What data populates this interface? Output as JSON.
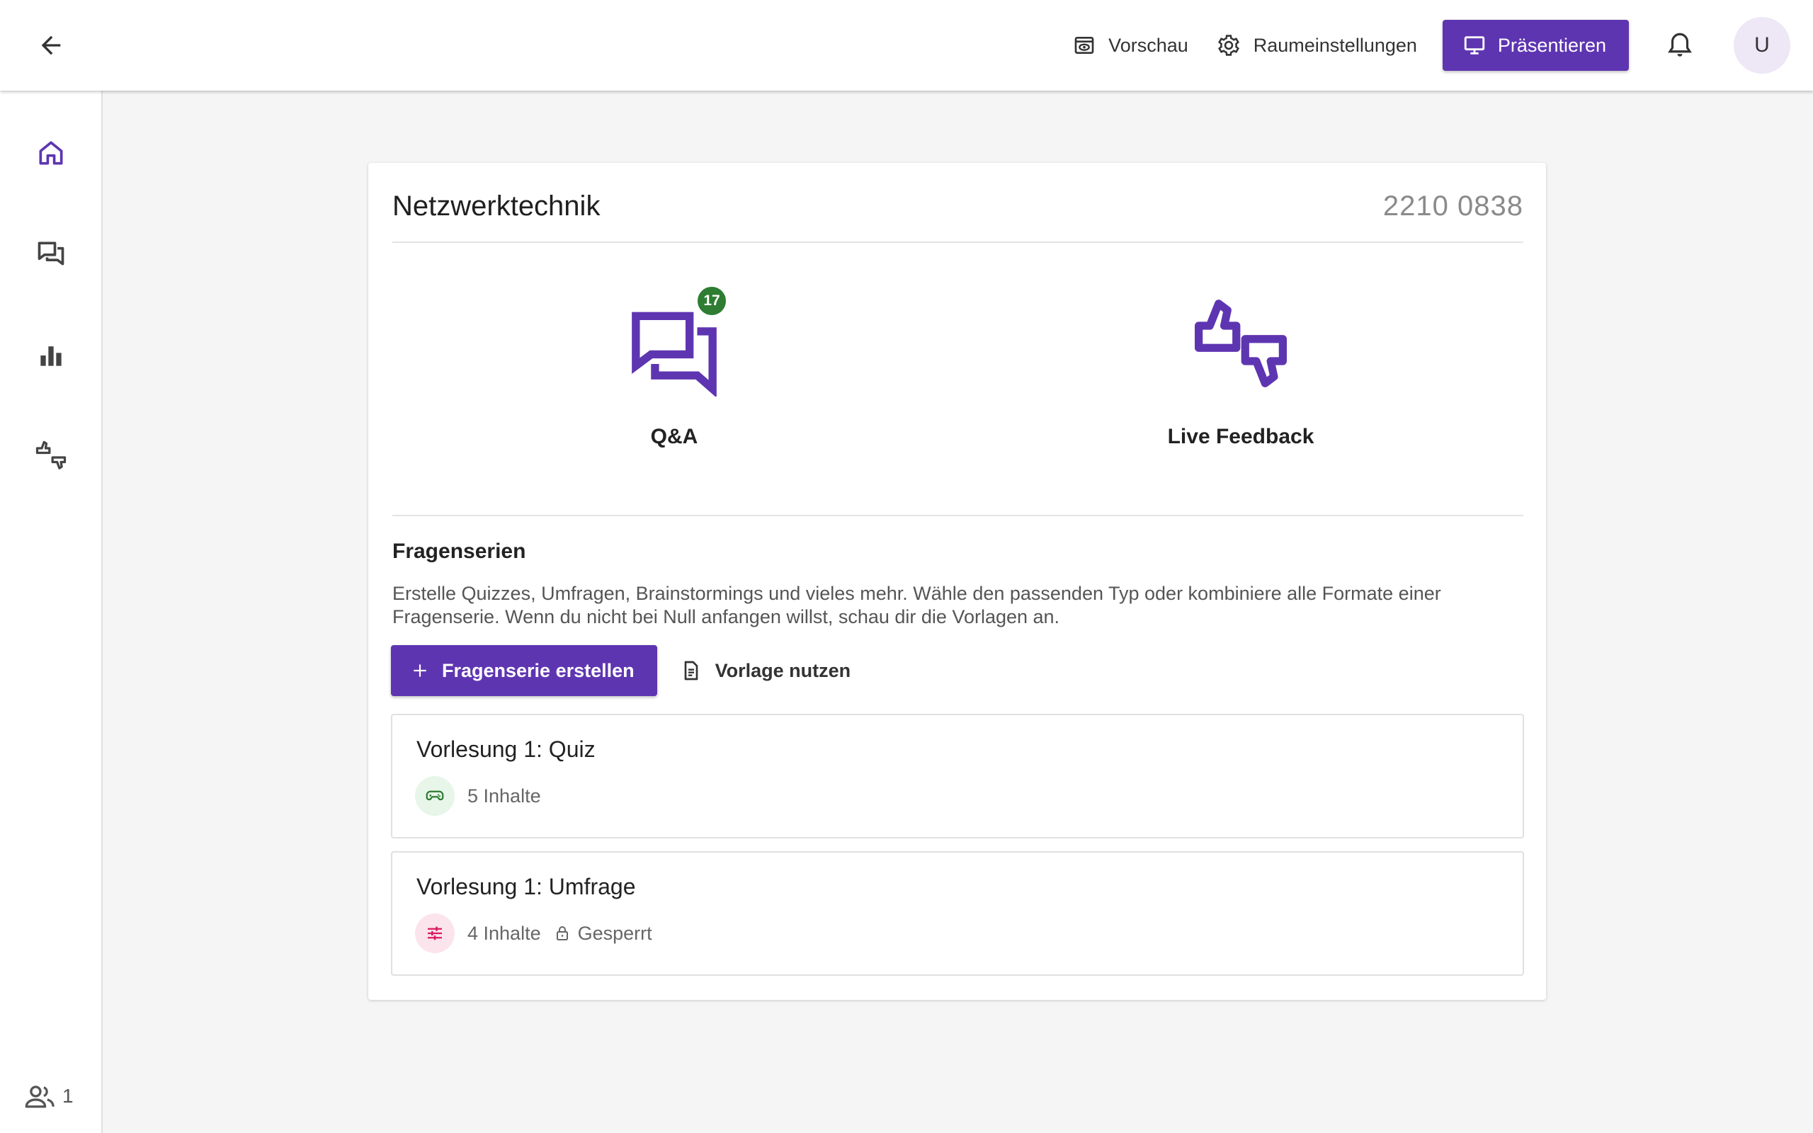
{
  "topbar": {
    "back_icon": "arrow-left-icon",
    "preview_label": "Vorschau",
    "settings_label": "Raumeinstellungen",
    "present_label": "Präsentieren",
    "avatar_initial": "U"
  },
  "sidebar": {
    "items": [
      {
        "name": "home",
        "icon": "home-icon",
        "active": true
      },
      {
        "name": "qna",
        "icon": "chat-bubbles-icon",
        "active": false
      },
      {
        "name": "series",
        "icon": "bar-chart-icon",
        "active": false
      },
      {
        "name": "feedback",
        "icon": "thumbs-up-down-icon",
        "active": false
      }
    ],
    "online_count": "1"
  },
  "room": {
    "name": "Netzwerktechnik",
    "code": "2210 0838"
  },
  "features": {
    "qna": {
      "label": "Q&A",
      "badge": "17"
    },
    "feedback": {
      "label": "Live Feedback"
    }
  },
  "series_section": {
    "title": "Fragenserien",
    "description": "Erstelle Quizzes, Umfragen, Brainstormings und vieles mehr. Wähle den passenden Typ oder kombiniere alle Formate einer Fragenserie. Wenn du nicht bei Null anfangen willst, schau dir die Vorlagen an.",
    "create_label": "Fragenserie erstellen",
    "template_label": "Vorlage nutzen",
    "items": [
      {
        "title": "Vorlesung 1: Quiz",
        "count": "5 Inhalte",
        "type_icon": "gamepad-icon"
      },
      {
        "title": "Vorlesung 1: Umfrage",
        "count": "4 Inhalte",
        "type_icon": "sliders-icon",
        "locked_label": "Gesperrt"
      }
    ]
  },
  "colors": {
    "primary": "#5e35b1",
    "badge_green": "#2e7d32",
    "quiz_bg": "#e8f5e9",
    "quiz_icon": "#2e7d32",
    "survey_bg": "#fce4ec",
    "survey_icon": "#d81b60"
  }
}
